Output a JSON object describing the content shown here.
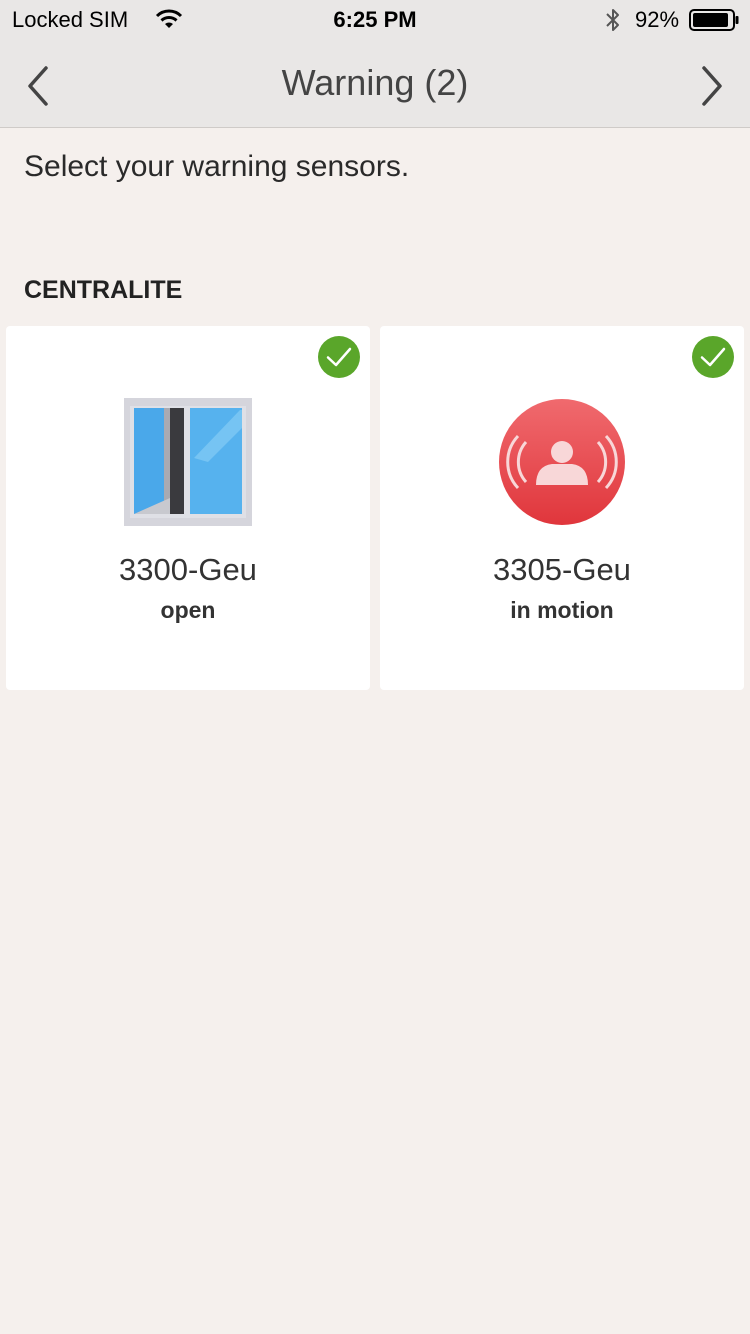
{
  "status_bar": {
    "carrier": "Locked SIM",
    "time": "6:25 PM",
    "battery_percent": "92%",
    "battery_level": 0.92,
    "icons": [
      "wifi-icon",
      "bluetooth-icon",
      "battery-icon"
    ]
  },
  "nav": {
    "title": "Warning (2)",
    "back_icon": "chevron-left-icon",
    "forward_icon": "chevron-right-icon"
  },
  "instruction": "Select your warning sensors.",
  "section": {
    "title": "CENTRALITE"
  },
  "sensors": [
    {
      "name": "3300-Geu",
      "state": "open",
      "icon": "window-open-icon",
      "selected": true
    },
    {
      "name": "3305-Geu",
      "state": "in motion",
      "icon": "motion-alarm-icon",
      "selected": true
    }
  ],
  "colors": {
    "check_green": "#5aa62a",
    "motion_red": "#e8454a",
    "window_blue": "#4aa8ea",
    "background": "#f5f0ed",
    "bar_background": "#e9e7e6"
  }
}
